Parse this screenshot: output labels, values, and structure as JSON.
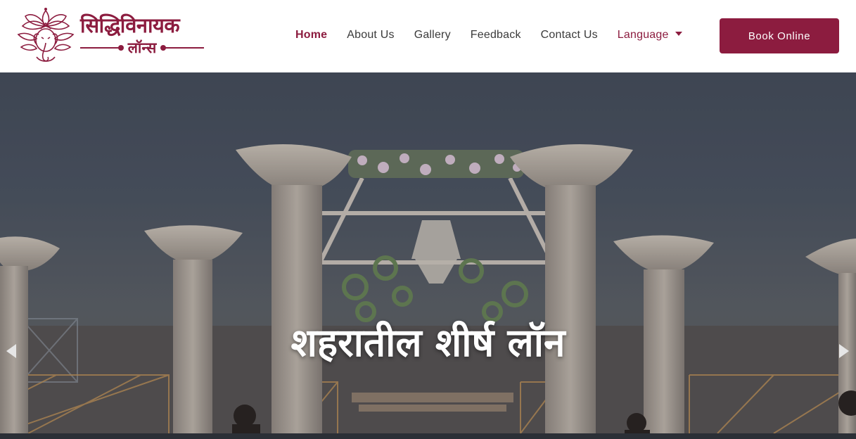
{
  "brand": {
    "name": "सिद्धिविनायक",
    "subtitle": "लॉन्स",
    "color": "#8c1c3f",
    "icon": "ganesha-lotus-logo"
  },
  "nav": {
    "items": [
      {
        "label": "Home",
        "active": true
      },
      {
        "label": "About Us",
        "active": false
      },
      {
        "label": "Gallery",
        "active": false
      },
      {
        "label": "Feedback",
        "active": false
      },
      {
        "label": "Contact Us",
        "active": false
      }
    ],
    "language_label": "Language"
  },
  "cta": {
    "book_label": "Book Online"
  },
  "hero": {
    "caption": "शहरातील शीर्ष लॉन",
    "image": "wedding-lawn-decorated-entrance",
    "prev_icon": "chevron-left-icon",
    "next_icon": "chevron-right-icon"
  }
}
